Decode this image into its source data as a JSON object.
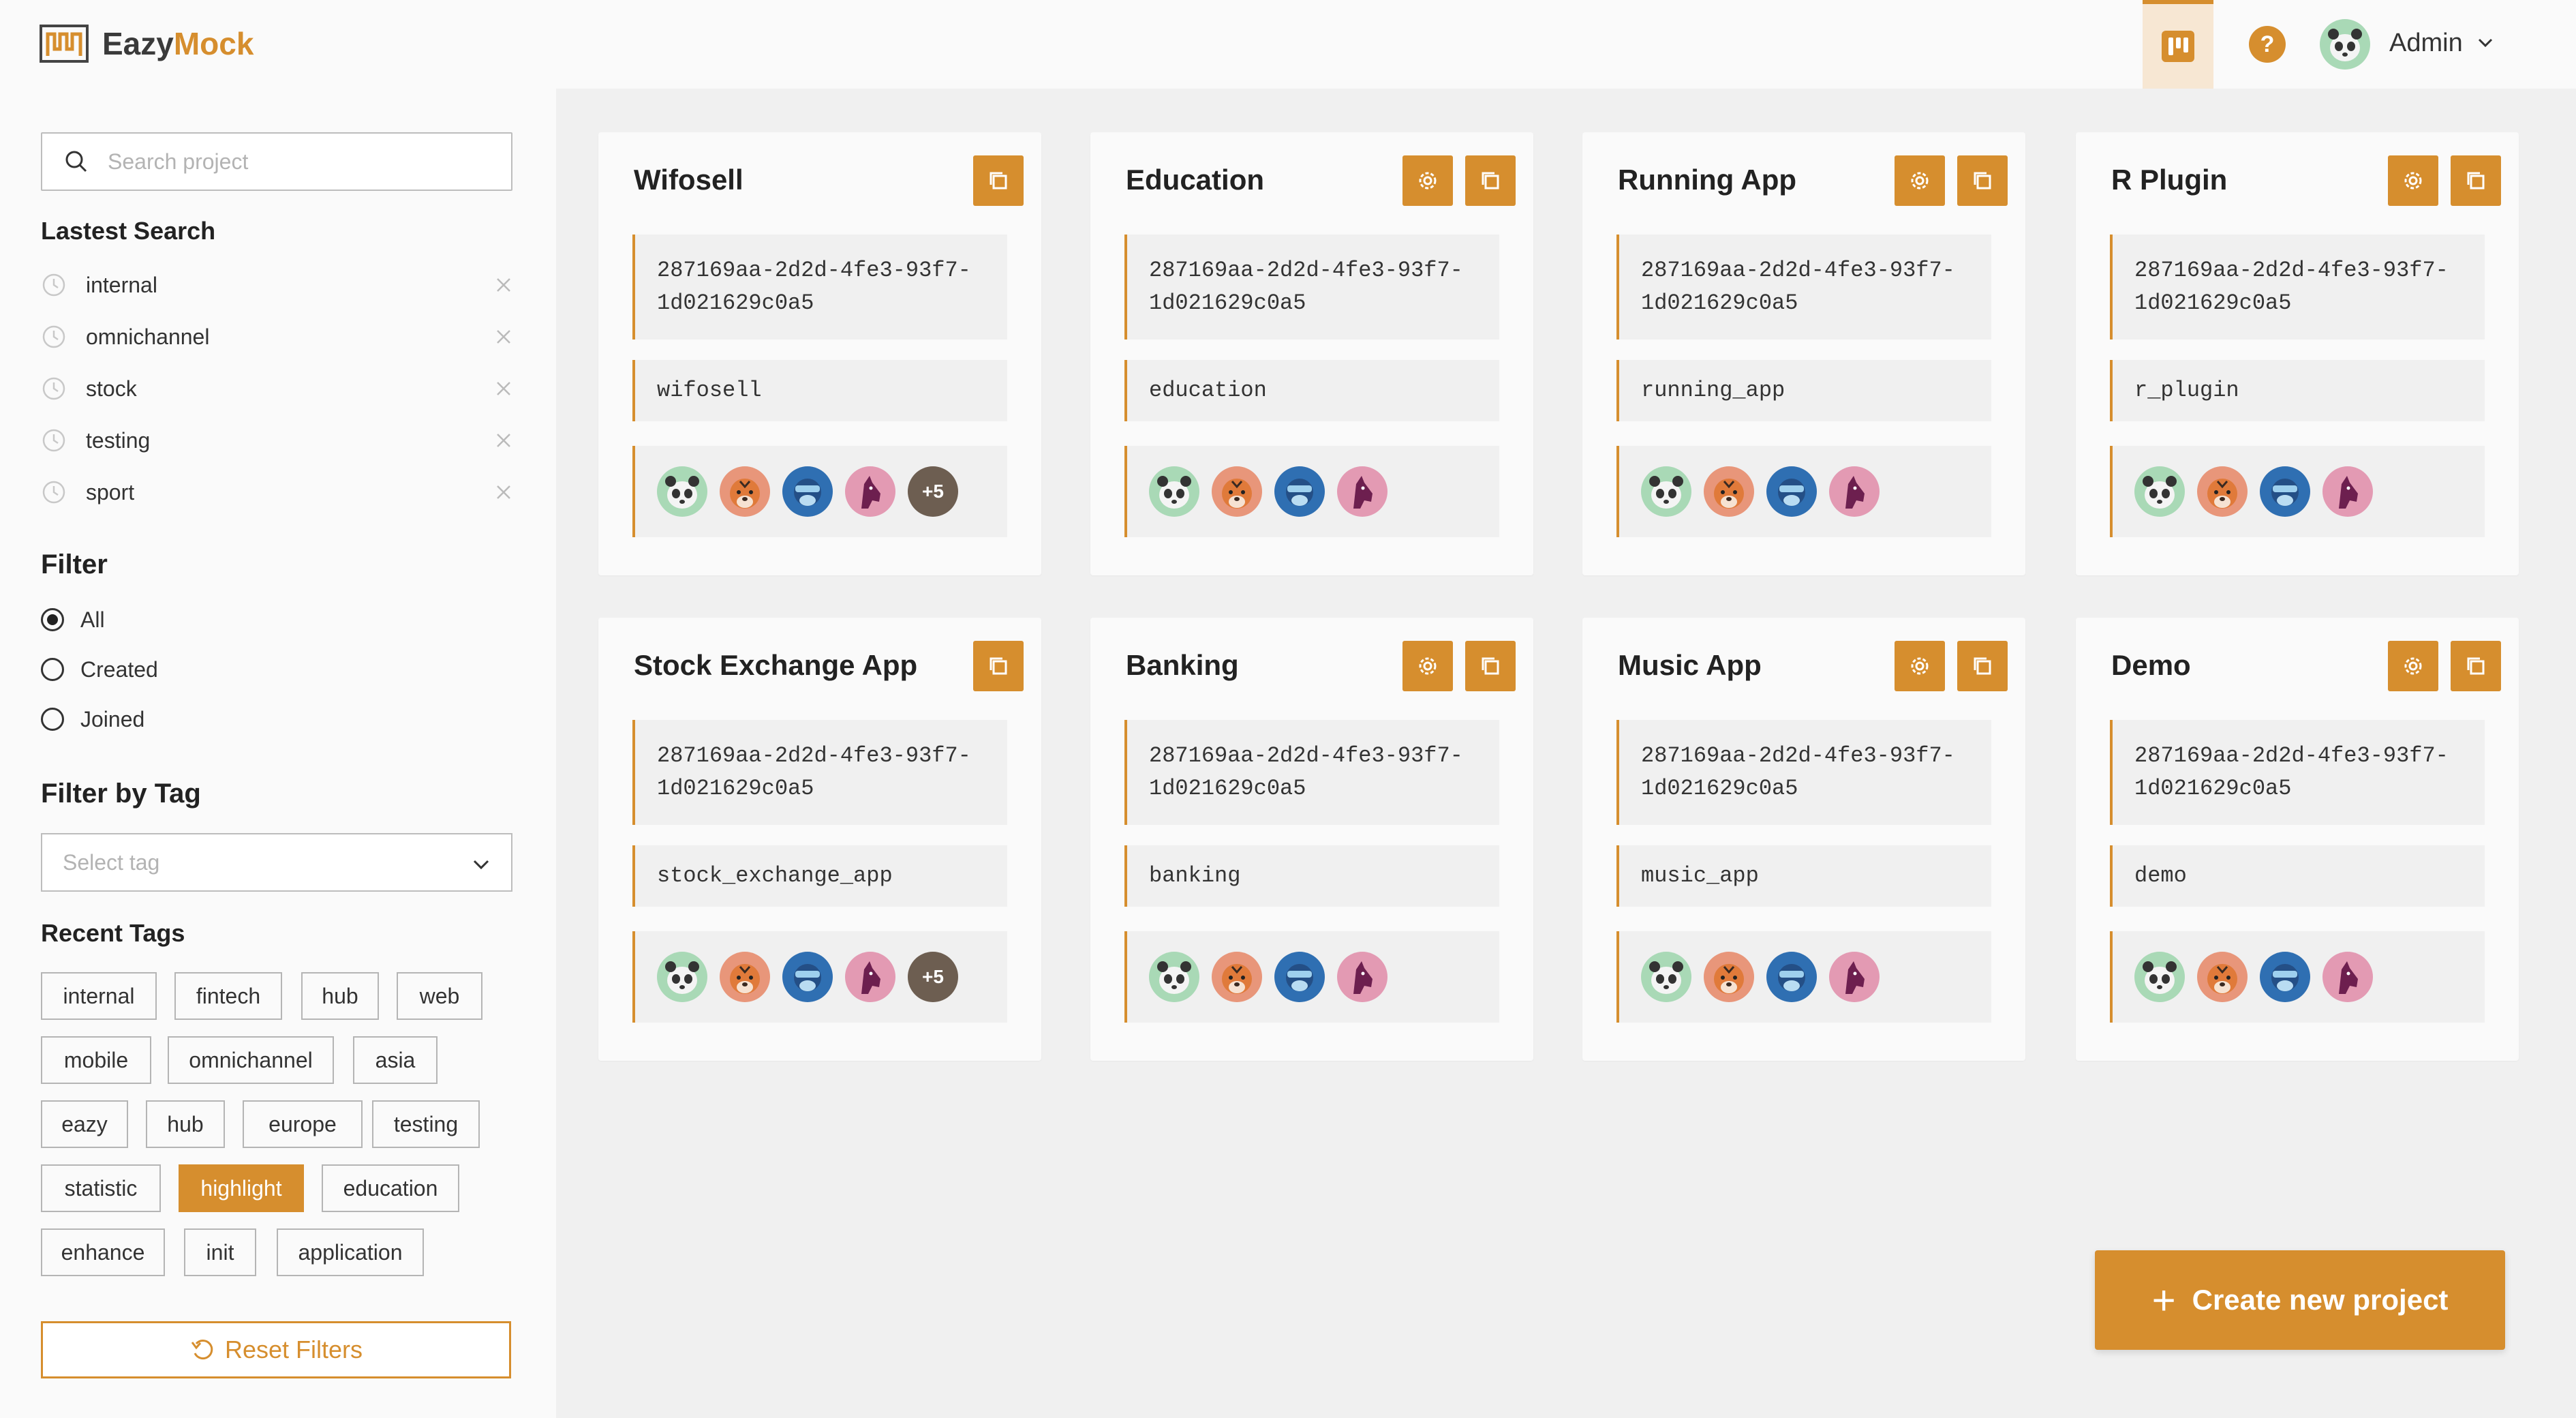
{
  "app": {
    "logo_text_main": "Eazy",
    "logo_text_accent": "Mock"
  },
  "header": {
    "user_name": "Admin",
    "help_label": "?"
  },
  "sidebar": {
    "search_placeholder": "Search project",
    "latest_title": "Lastest Search",
    "latest": [
      "internal",
      "omnichannel",
      "stock",
      "testing",
      "sport"
    ],
    "filter_title": "Filter",
    "filter_options": [
      "All",
      "Created",
      "Joined"
    ],
    "filter_selected": "All",
    "tag_filter_title": "Filter by Tag",
    "tag_placeholder": "Select tag",
    "recent_tags_title": "Recent Tags",
    "tags": [
      "internal",
      "fintech",
      "hub",
      "web",
      "mobile",
      "omnichannel",
      "asia",
      "eazy",
      "hub",
      "europe",
      "testing",
      "statistic",
      "highlight",
      "education",
      "enhance",
      "init",
      "application"
    ],
    "active_tag": "highlight",
    "reset_label": "Reset Filters"
  },
  "projects": [
    {
      "title": "Wifosell",
      "id": "287169aa-2d2d-4fe3-93f7-\n1d021629c0a5",
      "slug": "wifosell",
      "more": "+5"
    },
    {
      "title": "Education",
      "id": "287169aa-2d2d-4fe3-93f7-\n1d021629c0a5",
      "slug": "education",
      "more": ""
    },
    {
      "title": "Running App",
      "id": "287169aa-2d2d-4fe3-93f7-\n1d021629c0a5",
      "slug": "running_app",
      "more": ""
    },
    {
      "title": "R Plugin",
      "id": "287169aa-2d2d-4fe3-93f7-\n1d021629c0a5",
      "slug": "r_plugin",
      "more": ""
    },
    {
      "title": "Stock Exchange App",
      "id": "287169aa-2d2d-4fe3-93f7-\n1d021629c0a5",
      "slug": "stock_exchange_app",
      "more": "+5"
    },
    {
      "title": "Banking",
      "id": "287169aa-2d2d-4fe3-93f7-\n1d021629c0a5",
      "slug": "banking",
      "more": ""
    },
    {
      "title": "Music App",
      "id": "287169aa-2d2d-4fe3-93f7-\n1d021629c0a5",
      "slug": "music_app",
      "more": ""
    },
    {
      "title": "Demo",
      "id": "287169aa-2d2d-4fe3-93f7-\n1d021629c0a5",
      "slug": "demo",
      "more": ""
    }
  ],
  "create_label": "Create new project",
  "colors": {
    "accent": "#d68e2e",
    "panda_bg": "#a9d9b6",
    "tiger_bg": "#e8967a",
    "gorilla_bg": "#2f6fb2",
    "horse_bg": "#e39ab3"
  }
}
